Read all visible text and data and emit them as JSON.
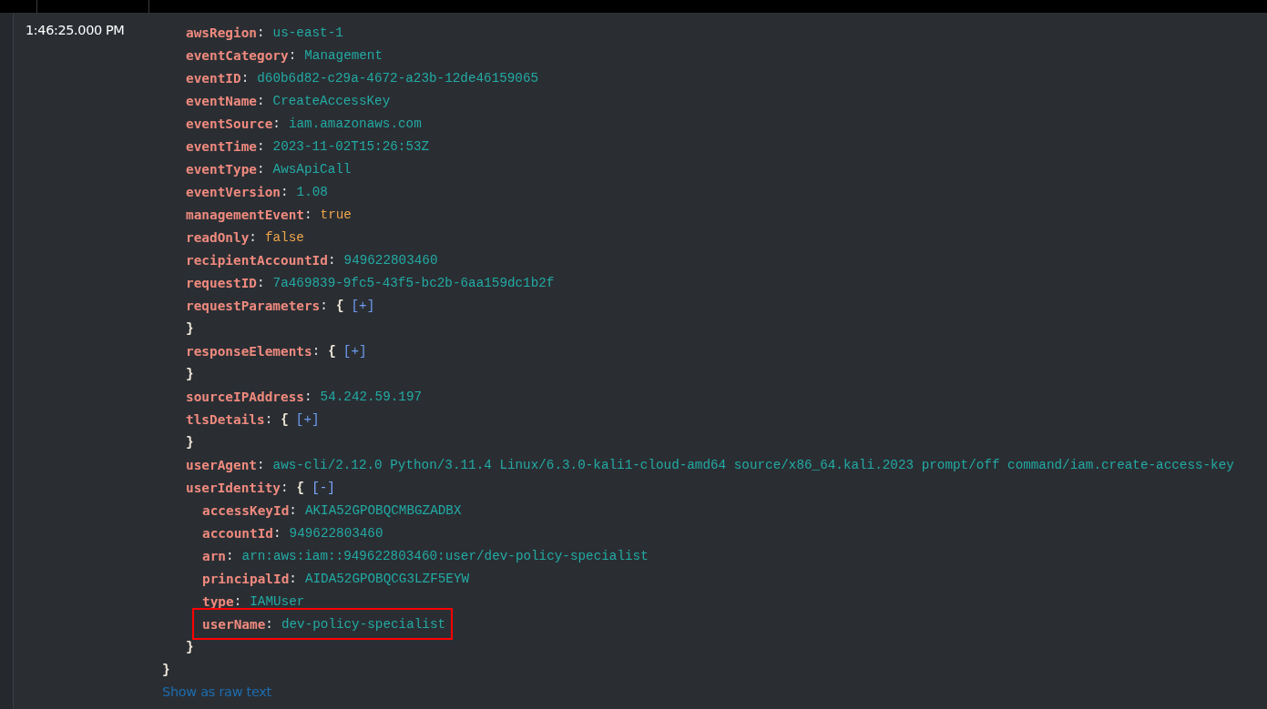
{
  "timestamp": "1:46:25.000 PM",
  "separator": ":",
  "fields": [
    {
      "key": "awsRegion",
      "kind": "string",
      "value": "us-east-1"
    },
    {
      "key": "eventCategory",
      "kind": "string",
      "value": "Management"
    },
    {
      "key": "eventID",
      "kind": "string",
      "value": "d60b6d82-c29a-4672-a23b-12de46159065"
    },
    {
      "key": "eventName",
      "kind": "string",
      "value": "CreateAccessKey"
    },
    {
      "key": "eventSource",
      "kind": "string",
      "value": "iam.amazonaws.com"
    },
    {
      "key": "eventTime",
      "kind": "string",
      "value": "2023-11-02T15:26:53Z"
    },
    {
      "key": "eventType",
      "kind": "string",
      "value": "AwsApiCall"
    },
    {
      "key": "eventVersion",
      "kind": "string",
      "value": "1.08"
    },
    {
      "key": "managementEvent",
      "kind": "boolean",
      "value": "true"
    },
    {
      "key": "readOnly",
      "kind": "boolean",
      "value": "false"
    },
    {
      "key": "recipientAccountId",
      "kind": "string",
      "value": "949622803460"
    },
    {
      "key": "requestID",
      "kind": "string",
      "value": "7a469839-9fc5-43f5-bc2b-6aa159dc1b2f"
    },
    {
      "key": "requestParameters",
      "kind": "object",
      "open_brace": "{",
      "toggle": "[+]",
      "expanded": false,
      "close_brace": "}"
    },
    {
      "key": "responseElements",
      "kind": "object",
      "open_brace": "{",
      "toggle": "[+]",
      "expanded": false,
      "close_brace": "}"
    },
    {
      "key": "sourceIPAddress",
      "kind": "string",
      "value": "54.242.59.197"
    },
    {
      "key": "tlsDetails",
      "kind": "object",
      "open_brace": "{",
      "toggle": "[+]",
      "expanded": false,
      "close_brace": "}"
    },
    {
      "key": "userAgent",
      "kind": "string",
      "value": "aws-cli/2.12.0 Python/3.11.4 Linux/6.3.0-kali1-cloud-amd64 source/x86_64.kali.2023 prompt/off command/iam.create-access-key"
    },
    {
      "key": "userIdentity",
      "kind": "object",
      "open_brace": "{",
      "toggle": "[-]",
      "expanded": true,
      "close_brace": "}",
      "children": [
        {
          "key": "accessKeyId",
          "kind": "string",
          "value": "AKIA52GPOBQCMBGZADBX",
          "highlighted": false
        },
        {
          "key": "accountId",
          "kind": "string",
          "value": "949622803460",
          "highlighted": false
        },
        {
          "key": "arn",
          "kind": "string",
          "value": "arn:aws:iam::949622803460:user/dev-policy-specialist",
          "highlighted": false
        },
        {
          "key": "principalId",
          "kind": "string",
          "value": "AIDA52GPOBQCG3LZF5EYW",
          "highlighted": false
        },
        {
          "key": "type",
          "kind": "string",
          "value": "IAMUser",
          "highlighted": false
        },
        {
          "key": "userName",
          "kind": "string",
          "value": "dev-policy-specialist",
          "highlighted": true
        }
      ]
    }
  ],
  "closing_brace": "}",
  "raw_text_link": "Show as raw text"
}
